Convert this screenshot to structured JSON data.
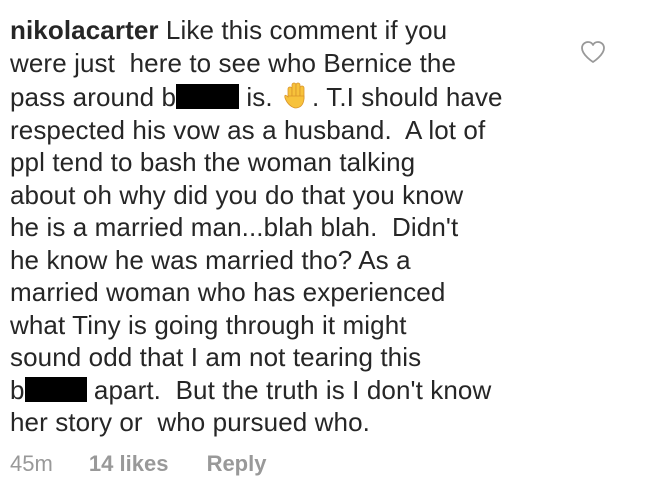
{
  "comment": {
    "username": "nikolacarter",
    "lines": [
      " Like this comment if you",
      "were just  here to see who Bernice the",
      "pass around b",
      " is. ",
      ". T.I should have",
      "respected his vow as a husband.  A lot of",
      "ppl tend to bash the woman talking",
      "about oh why did you do that you know",
      "he is a married man...blah blah.  Didn't",
      "he know he was married tho? As a",
      "married woman who has experienced",
      "what Tiny is going through it might",
      "sound odd that I am not tearing this",
      "b",
      " apart.  But the truth is I don't know",
      "her story or  who pursued who."
    ],
    "emoji_icon": "raised-hand-emoji"
  },
  "meta": {
    "time": "45m",
    "likes": "14 likes",
    "reply": "Reply"
  },
  "icons": {
    "like": "heart-outline-icon"
  }
}
